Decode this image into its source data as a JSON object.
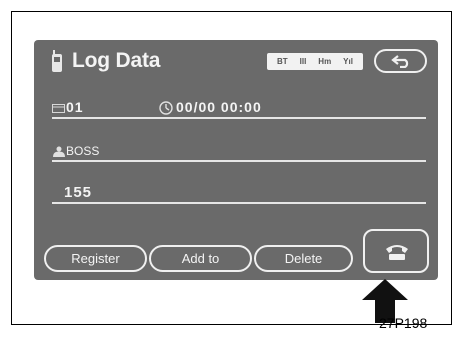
{
  "screen": {
    "title": "Log Data",
    "icons": {
      "phone": "mobile-phone-icon",
      "back": "back-arrow-icon",
      "dial": "handset-icon",
      "signal": "signal-strength-icon"
    },
    "status": {
      "a": "BT",
      "b": "III",
      "c": "Hm",
      "d": "Yıl"
    }
  },
  "fields": {
    "number_index": "01",
    "datetime": "00/00 00:00",
    "name": "BOSS",
    "phone_number": "155"
  },
  "buttons": {
    "register": "Register",
    "add_to": "Add to",
    "delete": "Delete"
  },
  "caption": "27P198",
  "colors": {
    "screen_bg": "#6a6a6a",
    "text": "#f4f4f4"
  }
}
